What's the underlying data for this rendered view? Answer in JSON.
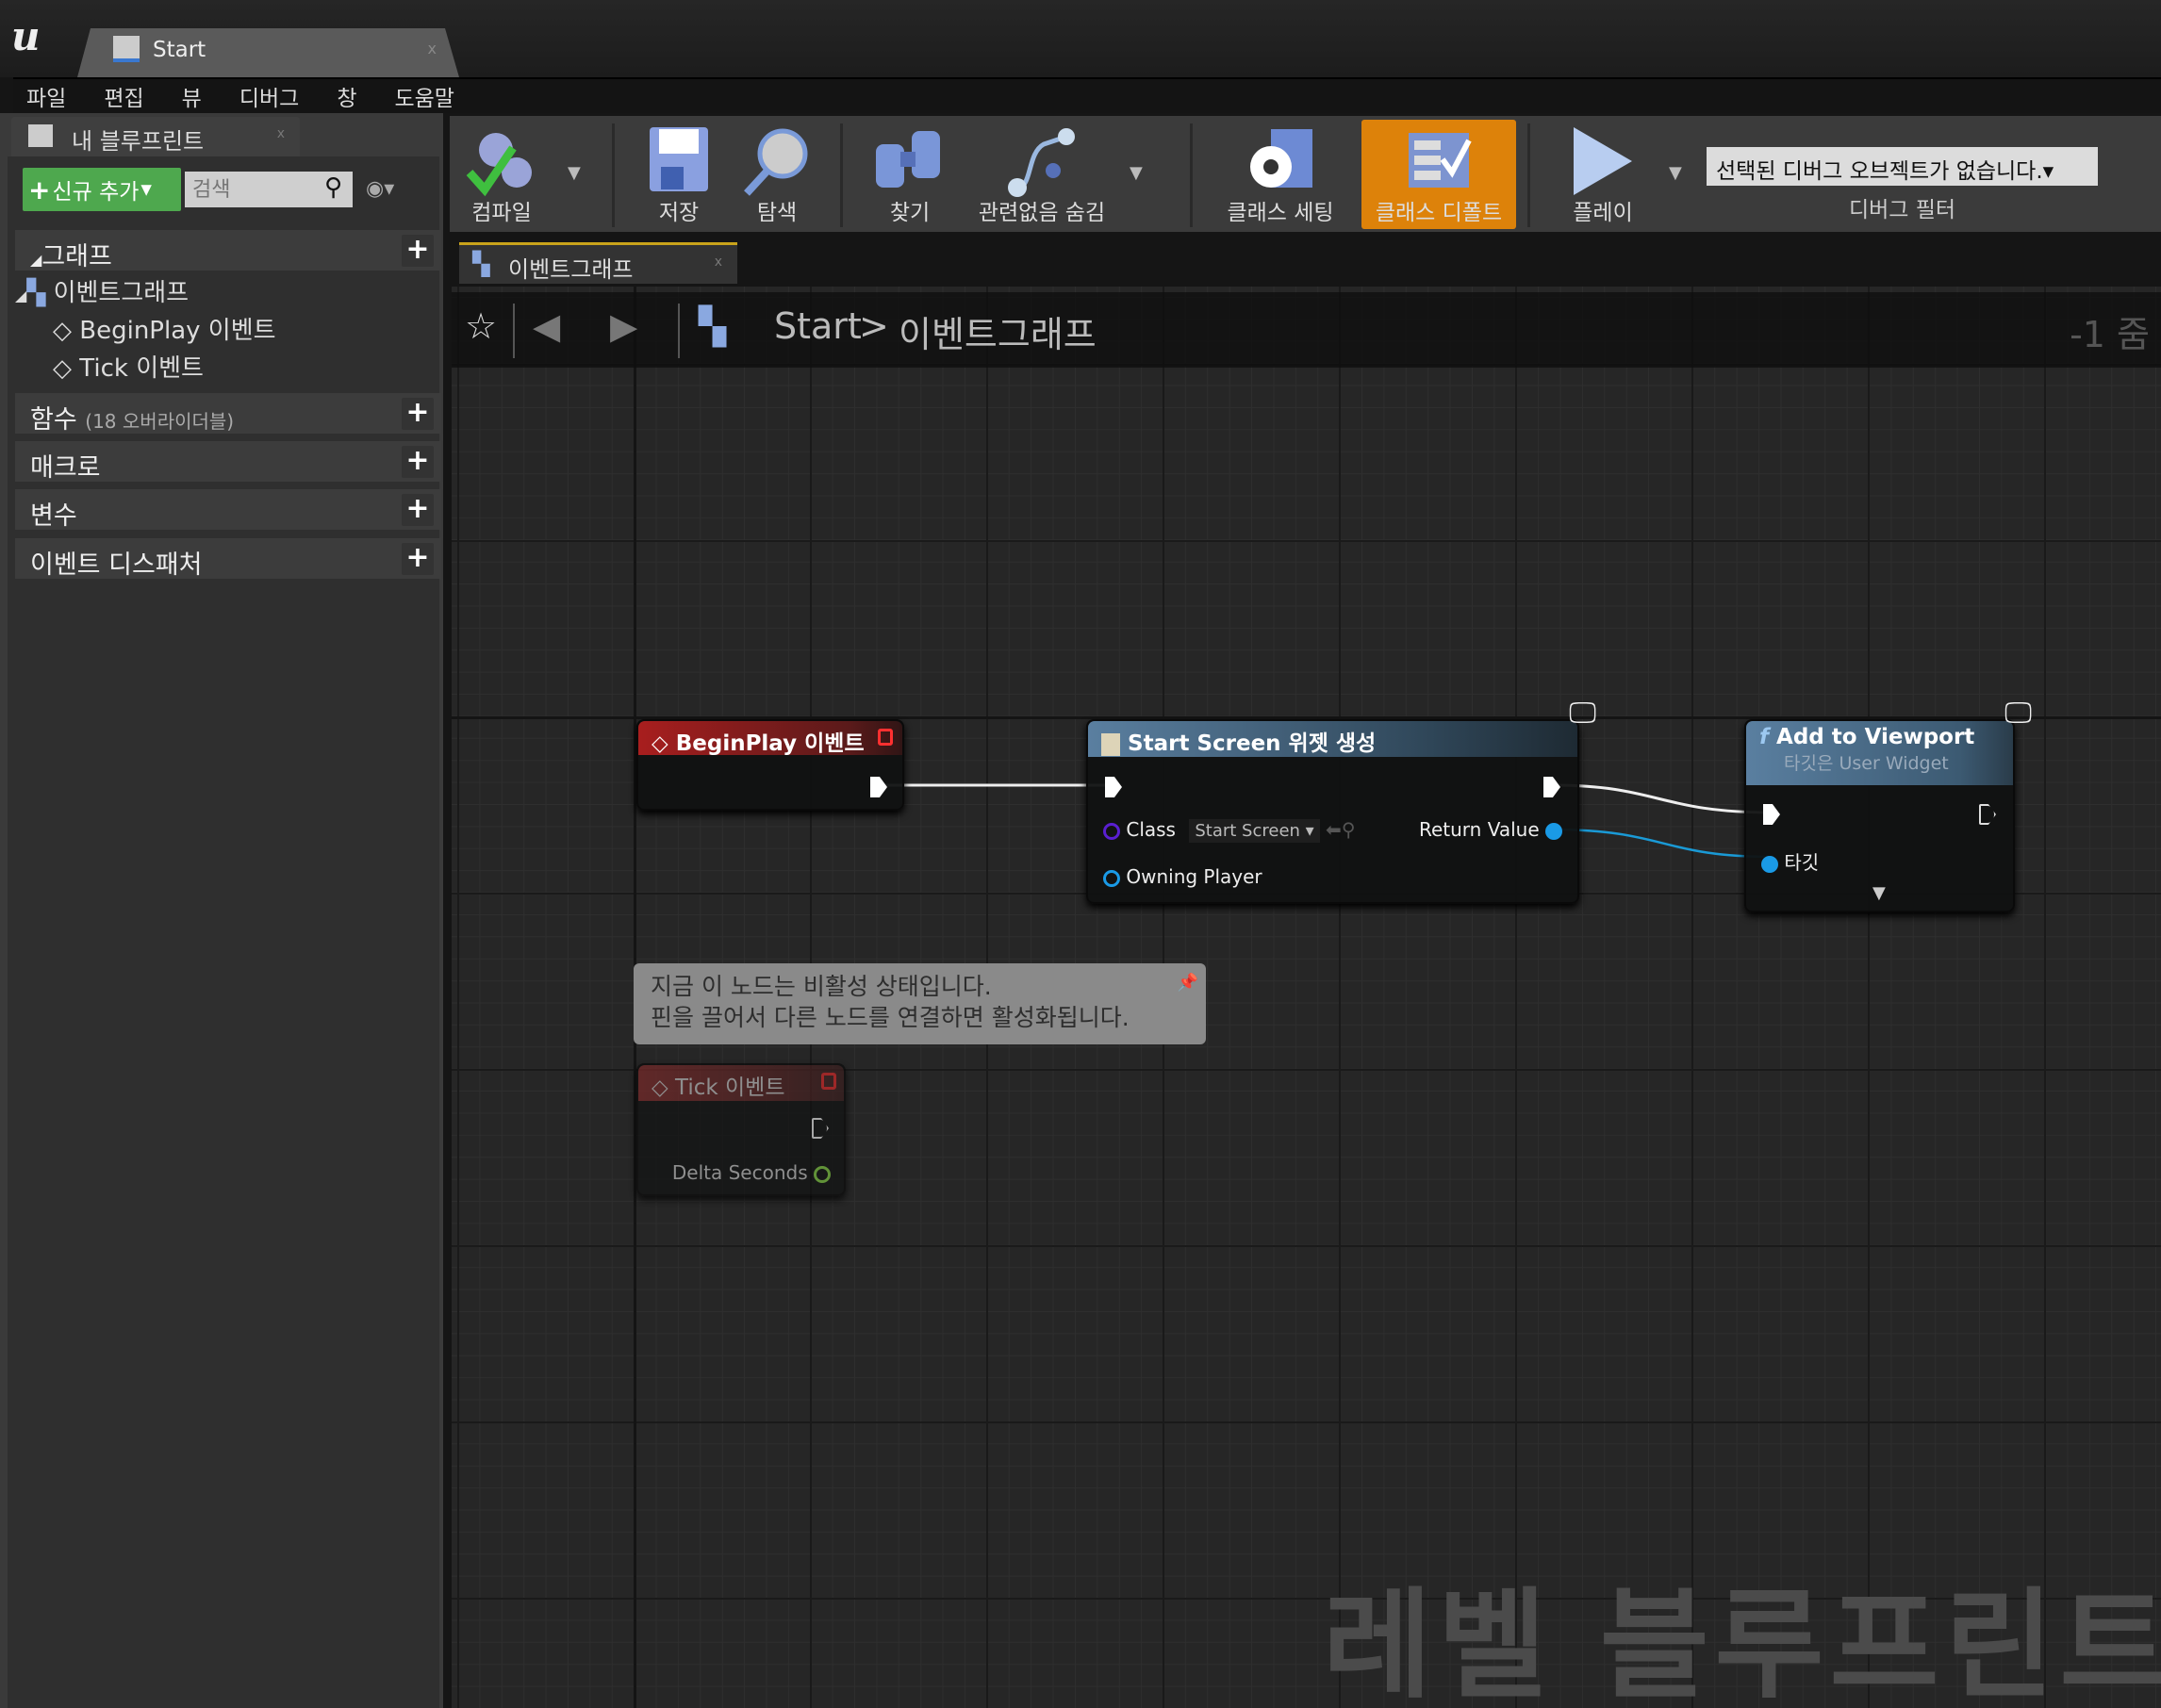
{
  "app": {
    "logo": "u",
    "document_tab": "Start",
    "tab_close": "x"
  },
  "menu": [
    "파일",
    "편집",
    "뷰",
    "디버그",
    "창",
    "도움말"
  ],
  "my_blueprint": {
    "tab": "내 블루프린트",
    "add_new": "신규 추가",
    "search_placeholder": "검색",
    "sections": {
      "graphs": "그래프",
      "event_graph": "이벤트그래프",
      "events": [
        "BeginPlay 이벤트",
        "Tick 이벤트"
      ],
      "functions": "함수",
      "functions_sub": "(18 오버라이더블)",
      "macros": "매크로",
      "variables": "변수",
      "dispatchers": "이벤트 디스패처"
    }
  },
  "toolbar": {
    "compile": "컴파일",
    "save": "저장",
    "browse": "탐색",
    "find": "찾기",
    "hide_unrelated": "관련없음 숨김",
    "class_settings": "클래스 세팅",
    "class_defaults": "클래스 디폴트",
    "play": "플레이",
    "debug_object": "선택된 디버그 오브젝트가 없습니다.",
    "debug_filter": "디버그 필터",
    "active_color": "#dd820a"
  },
  "graph": {
    "tab": "이벤트그래프",
    "breadcrumb": {
      "root": "Start",
      "separator": ">",
      "current": "이벤트그래프"
    },
    "zoom": "-1 줌",
    "watermark": "레벨 블루프린트",
    "nodes": {
      "begin_play": {
        "title": "BeginPlay 이벤트",
        "color": "#9c1c1c"
      },
      "create_widget": {
        "title": "Start Screen 위젯 생성",
        "class_label": "Class",
        "class_value": "Start Screen",
        "return_value": "Return Value",
        "owning_player": "Owning Player",
        "color": "#4a6a84"
      },
      "add_to_viewport": {
        "title": "Add to Viewport",
        "subtitle": "타깃은 User Widget",
        "target": "타깃",
        "color": "#4a6a84"
      },
      "tick": {
        "title": "Tick 이벤트",
        "delta_seconds": "Delta Seconds"
      }
    },
    "comment": [
      "지금 이 노드는 비활성 상태입니다.",
      "핀을 끌어서 다른 노드를 연결하면 활성화됩니다."
    ]
  }
}
